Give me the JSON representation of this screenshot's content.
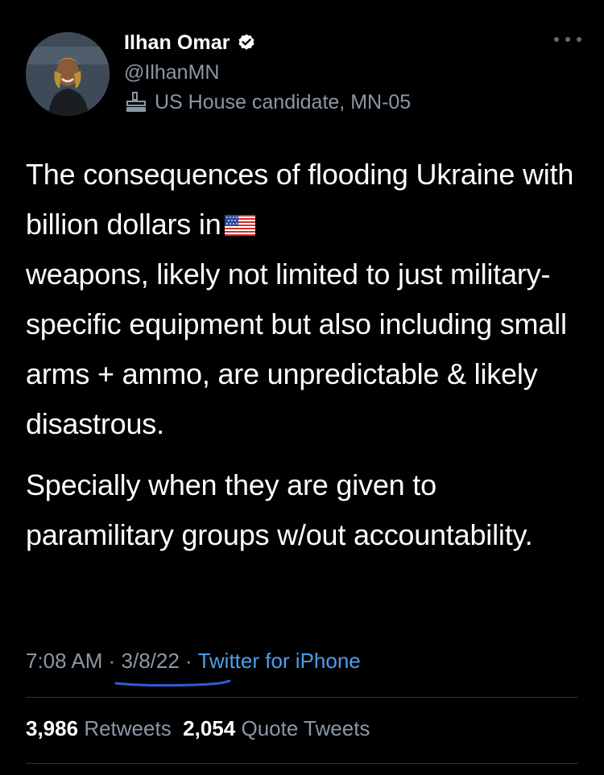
{
  "author": {
    "display_name": "Ilhan Omar",
    "handle": "@IlhanMN",
    "label": "US House candidate, MN-05",
    "verified": true
  },
  "tweet": {
    "line1_text": "The consequences of flooding Ukraine with billion dollars in",
    "line1_emoji": "us-flag-emoji",
    "line1_rest": "weapons, likely not limited to just military-specific equipment but also including small arms + ammo, are unpredictable & likely disastrous.",
    "paragraph2": "Specially when they are given to paramilitary groups w/out accountability."
  },
  "meta": {
    "time": "7:08 AM",
    "sep1": " · ",
    "date": "3/8/22",
    "sep2": " · ",
    "source": "Twitter for iPhone"
  },
  "stats": {
    "retweets_count": "3,986",
    "retweets_label": "Retweets",
    "quotes_count": "2,054",
    "quotes_label": "Quote Tweets"
  },
  "icons": {
    "verified": "verified-badge-icon",
    "label": "government-building-icon",
    "more": "more-options-icon",
    "flag": "us-flag-emoji"
  },
  "colors": {
    "background": "#000000",
    "text": "#ffffff",
    "secondary": "#8b98a5",
    "link": "#4c9eeb",
    "annotation_underline": "#2d5fd6"
  }
}
